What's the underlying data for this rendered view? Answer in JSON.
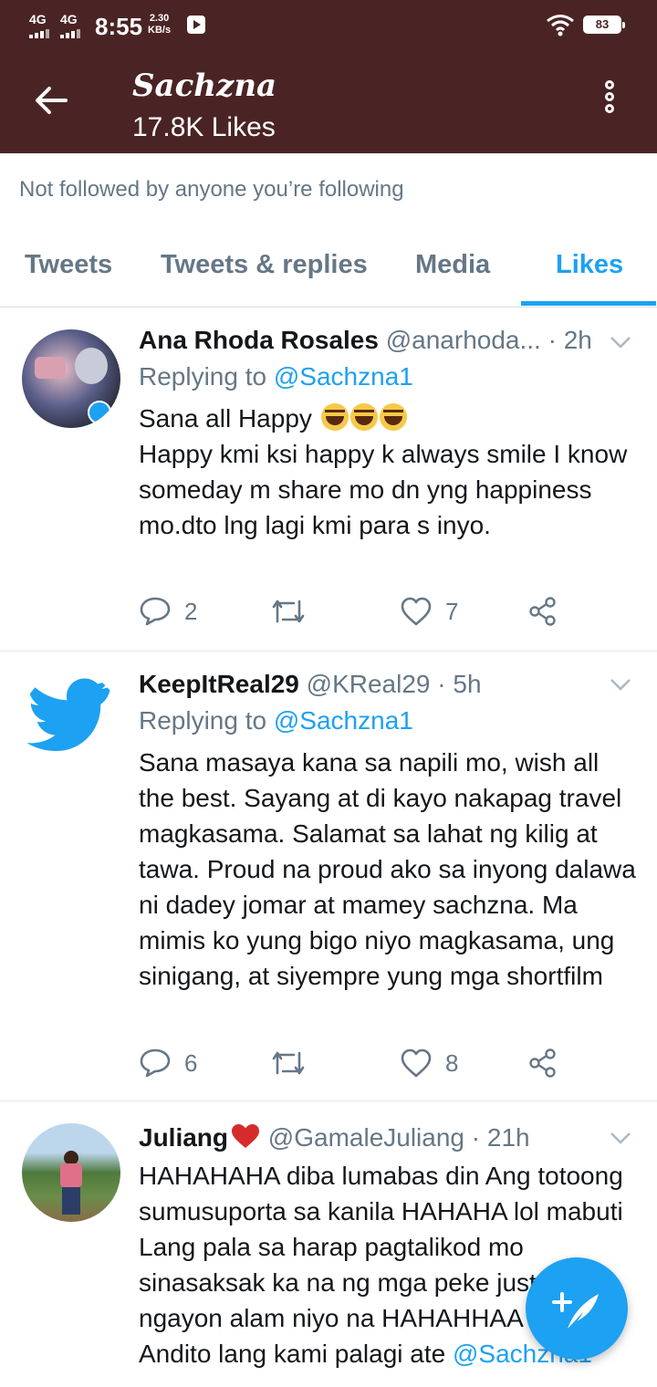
{
  "status_bar": {
    "signal1": "4G",
    "signal2": "4G",
    "time": "8:55",
    "speed_value": "2.30",
    "speed_unit": "KB/s",
    "battery": "83"
  },
  "header": {
    "title": "Sachzna",
    "subtitle": "17.8K Likes"
  },
  "profile": {
    "not_followed": "Not followed by anyone you’re following"
  },
  "tabs": [
    {
      "label": "Tweets",
      "active": false
    },
    {
      "label": "Tweets & replies",
      "active": false
    },
    {
      "label": "Media",
      "active": false
    },
    {
      "label": "Likes",
      "active": true
    }
  ],
  "tweets": [
    {
      "name": "Ana Rhoda Rosales",
      "meta": "@anarhoda... · 2h",
      "replying_prefix": "Replying to",
      "replying_to": "@Sachzna1",
      "text_line1": "Sana all Happy",
      "text_rest": "Happy kmi ksi happy k always smile I know someday m share mo dn yng happiness mo.dto lng lagi kmi para s inyo.",
      "replies": "2",
      "retweets": "",
      "likes": "7"
    },
    {
      "name": "KeepItReal29",
      "meta": "@KReal29 · 5h",
      "replying_prefix": "Replying to",
      "replying_to": "@Sachzna1",
      "text": "Sana masaya kana sa napili mo, wish all the best. Sayang at di kayo nakapag travel magkasama. Salamat sa lahat ng kilig at tawa. Proud na proud ako sa inyong dalawa ni dadey jomar at mamey sachzna. Ma mimis ko yung bigo niyo magkasama, ung sinigang, at siyempre yung mga shortfilm",
      "replies": "6",
      "retweets": "",
      "likes": "8"
    },
    {
      "name": "Juliang",
      "meta": "@GamaleJuliang · 21h",
      "text": "HAHAHAHA diba lumabas din Ang totoong sumusuporta sa kanila HAHAHA lol mabuti Lang pala sa harap pagtalikod mo sinasaksak ka na ng mga peke just saying  ngayon alam niyo na HAHAHHAA",
      "text_cut_prefix": "Andito lang kami palagi ate",
      "text_cut_mention": "@Sachzna1"
    }
  ],
  "colors": {
    "header_bg": "#4a2424",
    "accent": "#1da1f2",
    "muted": "#657786"
  },
  "icons": [
    "back-arrow-icon",
    "more-vertical-icon",
    "reply-icon",
    "retweet-icon",
    "like-icon",
    "share-icon",
    "chevron-down-icon",
    "compose-icon"
  ]
}
